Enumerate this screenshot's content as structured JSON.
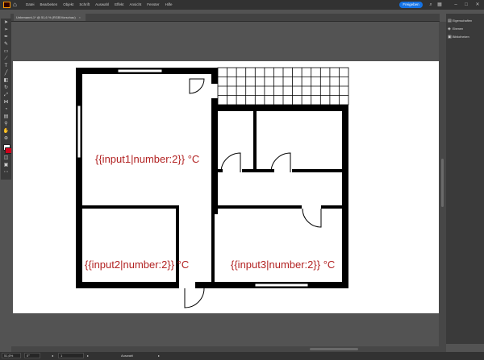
{
  "app": {
    "logo_text": "Ai"
  },
  "menu": {
    "items": [
      "Datei",
      "Bearbeiten",
      "Objekt",
      "Schrift",
      "Auswahl",
      "Effekt",
      "Ansicht",
      "Fenster",
      "Hilfe"
    ],
    "share_label": "Freigeben"
  },
  "document": {
    "tab_title": "Unbenannt-1* @ 51,6 % (RGB/Vorschau)",
    "close_glyph": "×"
  },
  "panel": {
    "items": [
      {
        "label": "Eigenschaften",
        "icon": "properties-icon"
      },
      {
        "label": "Ebenen",
        "icon": "layers-icon"
      },
      {
        "label": "Bibliotheken",
        "icon": "libraries-icon"
      }
    ]
  },
  "floorplan": {
    "labels": [
      "{{input1|number:2}} °C",
      "{{input2|number:2}} °C",
      "{{input3|number:2}} °C"
    ]
  },
  "statusbar": {
    "zoom": "51,6%",
    "rotation": "0°",
    "artboard_number": "1",
    "tool_name": "Auswahl"
  }
}
